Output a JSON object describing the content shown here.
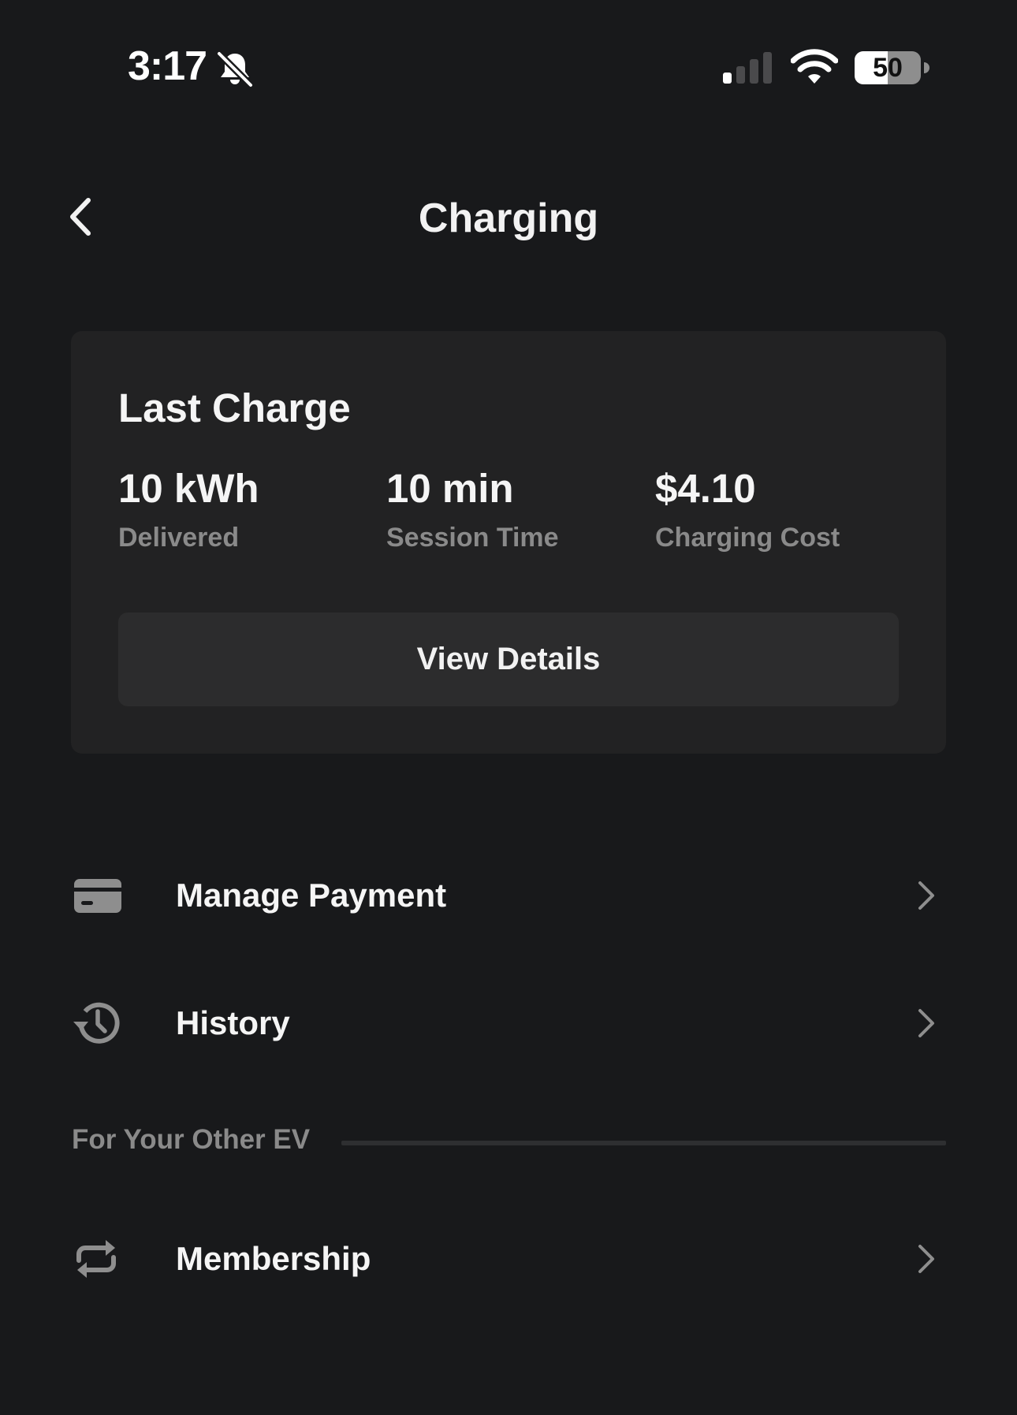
{
  "status_bar": {
    "time": "3:17",
    "silent_icon": "bell-slash-icon",
    "signal_icon": "cellular-signal-icon",
    "signal_bars_active": 1,
    "signal_bars_total": 4,
    "wifi_icon": "wifi-icon",
    "battery_icon": "battery-icon",
    "battery_percent": "50",
    "battery_level": 0.5
  },
  "nav": {
    "back_icon": "chevron-left-icon",
    "title": "Charging"
  },
  "last_charge": {
    "title": "Last Charge",
    "stats": [
      {
        "value": "10 kWh",
        "label": "Delivered"
      },
      {
        "value": "10 min",
        "label": "Session Time"
      },
      {
        "value": "$4.10",
        "label": "Charging Cost"
      }
    ],
    "details_button": "View Details"
  },
  "menu": [
    {
      "label": "Manage Payment",
      "icon": "credit-card-icon"
    },
    {
      "label": "History",
      "icon": "history-clock-icon"
    }
  ],
  "other_ev_section": {
    "label": "For Your Other EV",
    "items": [
      {
        "label": "Membership",
        "icon": "repeat-arrows-icon"
      }
    ]
  },
  "colors": {
    "background": "#18191b",
    "card": "#222223",
    "button": "#2c2c2d",
    "primary_text": "#f5f5f5",
    "secondary_text": "#8a8a8a",
    "icon_gray": "#8e8e8e"
  }
}
